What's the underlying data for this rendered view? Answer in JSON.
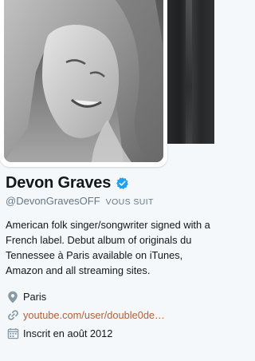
{
  "profile": {
    "name": "Devon Graves",
    "handle": "@DevonGravesOFF",
    "follows_you": "VOUS SUIT",
    "bio": "American folk singer/songwriter signed with a French label. Debut album of originals du Tennessee à Paris available on iTunes, Amazon and all streaming sites.",
    "location": "Paris",
    "website": "youtube.com/user/double0de…",
    "joined": "Inscrit en août 2012"
  },
  "icons": {
    "verified": "verified-badge-icon",
    "location": "location-pin-icon",
    "website": "link-icon",
    "joined": "calendar-icon"
  },
  "colors": {
    "verified": "#1da1f2",
    "link": "#b0623b",
    "secondary_text": "#657786",
    "meta_icon": "#8899a6"
  }
}
